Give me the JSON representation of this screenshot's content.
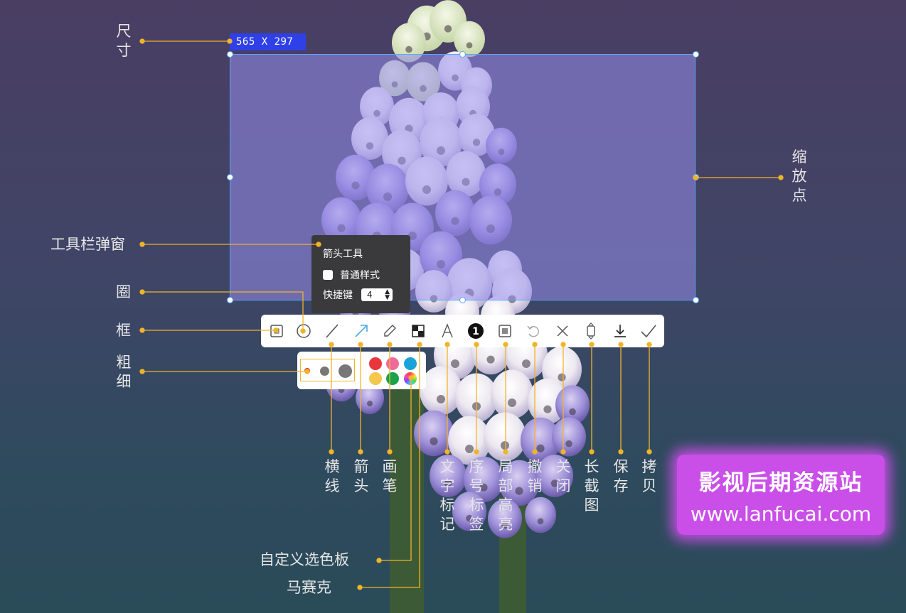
{
  "selection": {
    "size_text": "565 X 297"
  },
  "popup": {
    "title": "箭头工具",
    "checkbox_label": "普通样式",
    "shortcut_label": "快捷键",
    "shortcut_value": "4"
  },
  "toolbar": {
    "tools": [
      {
        "name": "rect-tool",
        "icon": "square-icon"
      },
      {
        "name": "circle-tool",
        "icon": "circle-icon"
      },
      {
        "name": "line-tool",
        "icon": "line-icon"
      },
      {
        "name": "arrow-tool",
        "icon": "arrow-icon"
      },
      {
        "name": "pen-tool",
        "icon": "pencil-icon"
      },
      {
        "name": "mosaic-tool",
        "icon": "mosaic-icon"
      },
      {
        "name": "text-tool",
        "icon": "text-a-icon"
      },
      {
        "name": "number-tool",
        "icon": "number-badge-icon"
      },
      {
        "name": "highlight-tool",
        "icon": "highlight-icon"
      },
      {
        "name": "undo-tool",
        "icon": "undo-icon"
      },
      {
        "name": "close-tool",
        "icon": "close-icon"
      },
      {
        "name": "long-screenshot-tool",
        "icon": "long-capture-icon"
      },
      {
        "name": "save-tool",
        "icon": "download-icon"
      },
      {
        "name": "copy-tool",
        "icon": "check-icon"
      }
    ],
    "active_color": "#4aa8e8"
  },
  "palette": {
    "sizes": [
      "small",
      "medium",
      "large"
    ],
    "selected_size_color": "#e8312f",
    "colors": [
      "#e8363c",
      "#ef6a9a",
      "#1aa3d8",
      "#f4c74f",
      "#1aa24a",
      "custom-gradient"
    ]
  },
  "annotations": {
    "size": "尺寸",
    "scale_points": "缩放点",
    "toolbar_popup": "工具栏弹窗",
    "circle": "圈",
    "frame": "框",
    "thickness": "粗细",
    "line": "横线",
    "arrow": "箭头",
    "pen": "画笔",
    "text_mark": "文字标记",
    "number_tag": "序号标签",
    "local_highlight": "局部高亮",
    "undo": "撤销",
    "close": "关闭",
    "long_capture": "长截图",
    "save": "保存",
    "copy": "拷贝",
    "custom_palette": "自定义选色板",
    "mosaic": "马赛克"
  },
  "watermark": {
    "line1": "影视后期资源站",
    "line2": "www.lanfucai.com"
  },
  "colors": {
    "annotation_line": "#f0b429",
    "selection_border": "#5aa6ff",
    "size_badge_bg": "#2e40e6"
  }
}
